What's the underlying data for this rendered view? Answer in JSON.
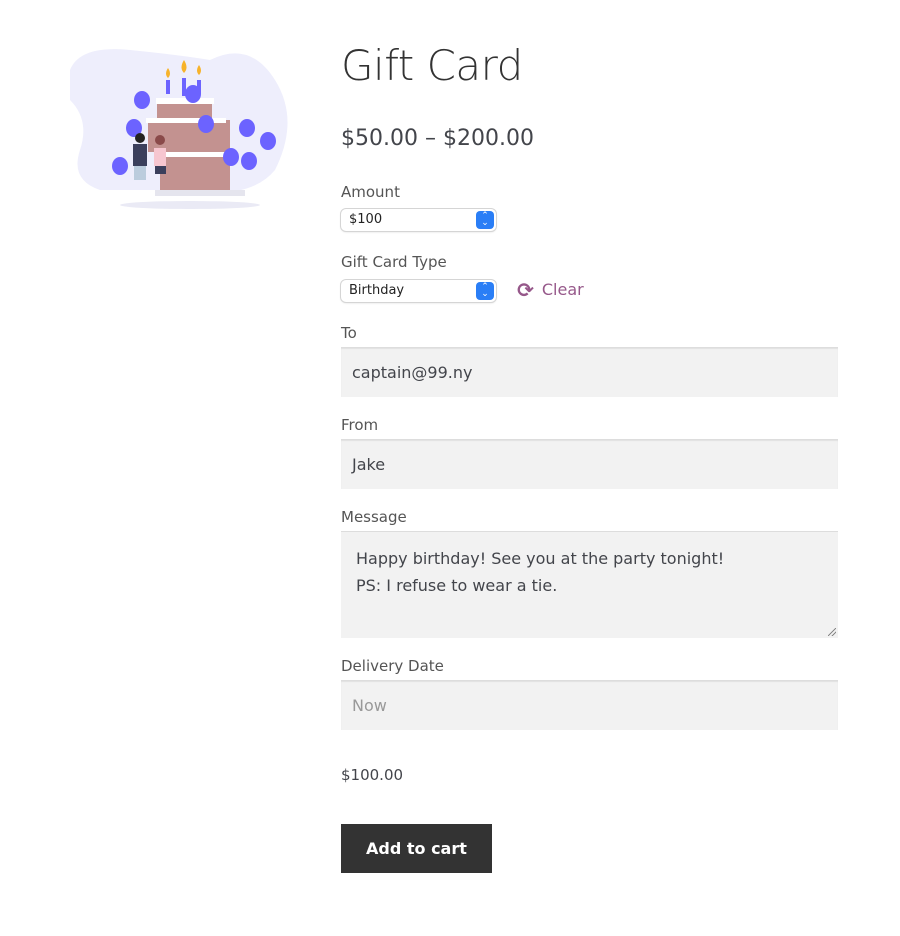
{
  "product": {
    "title": "Gift Card",
    "price_range": "$50.00 – $200.00",
    "image_icon": "birthday-cake-illustration"
  },
  "form": {
    "amount": {
      "label": "Amount",
      "value": "$100"
    },
    "type": {
      "label": "Gift Card Type",
      "value": "Birthday",
      "clear_label": "Clear",
      "clear_icon": "refresh-icon"
    },
    "to": {
      "label": "To",
      "value": "captain@99.ny"
    },
    "from": {
      "label": "From",
      "value": "Jake"
    },
    "message": {
      "label": "Message",
      "line1": "Happy birthday! See you at the party tonight!",
      "line2": "PS: I refuse to wear a tie."
    },
    "delivery": {
      "label": "Delivery Date",
      "placeholder": "Now"
    },
    "total": "$100.00",
    "add_to_cart": "Add to cart"
  },
  "colors": {
    "accent": "#96588a",
    "button": "#333333",
    "select_stepper": "#2a7ef6",
    "balloon": "#6c63ff"
  }
}
